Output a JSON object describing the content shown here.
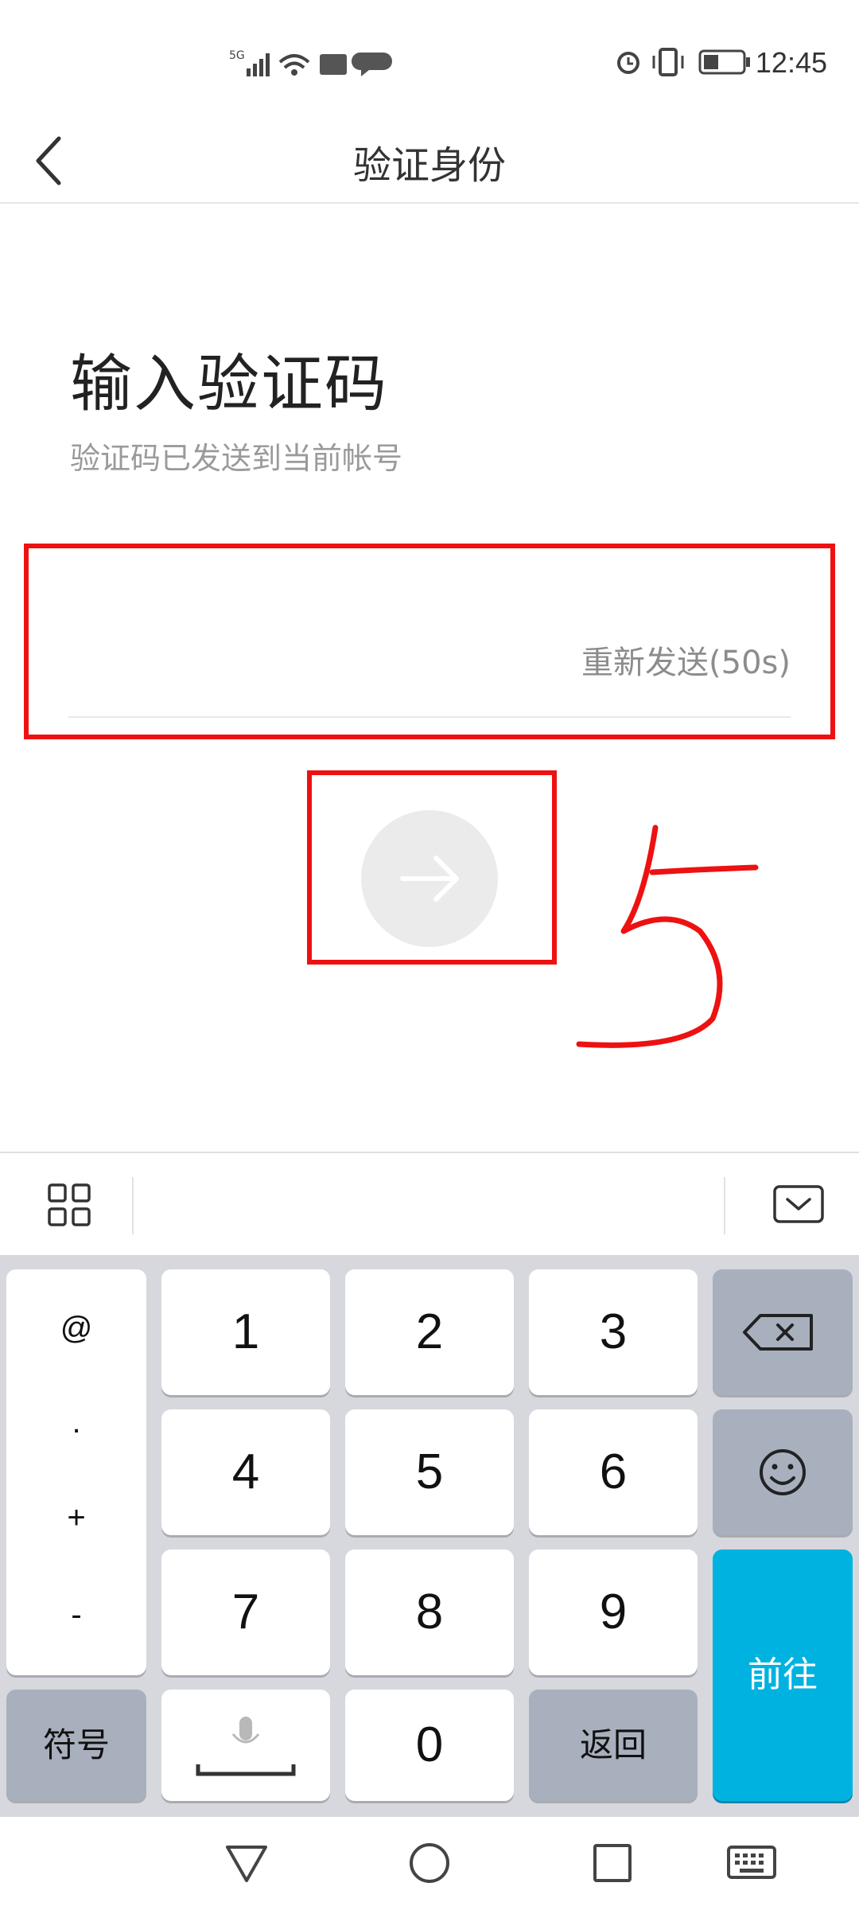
{
  "status_bar": {
    "network_label": "5G",
    "time": "12:45"
  },
  "header": {
    "title": "验证身份"
  },
  "main": {
    "heading": "输入验证码",
    "subtitle": "验证码已发送到当前帐号",
    "resend_label": "重新发送(50s)",
    "annotation_number": "5"
  },
  "keyboard": {
    "symbol_keys": [
      "@",
      ".",
      "+",
      "-"
    ],
    "digits": [
      "1",
      "2",
      "3",
      "4",
      "5",
      "6",
      "7",
      "8",
      "9",
      "0"
    ],
    "symbols_label": "符号",
    "back_label": "返回",
    "go_label": "前往"
  },
  "colors": {
    "highlight_red": "#ee1111",
    "go_blue": "#00b2e0"
  },
  "icons": {
    "toolbar_left": "grid-icon",
    "toolbar_right": "keyboard-hide-icon",
    "delete": "backspace-icon",
    "emoji": "smiley-icon",
    "voice": "microphone-space-icon"
  }
}
